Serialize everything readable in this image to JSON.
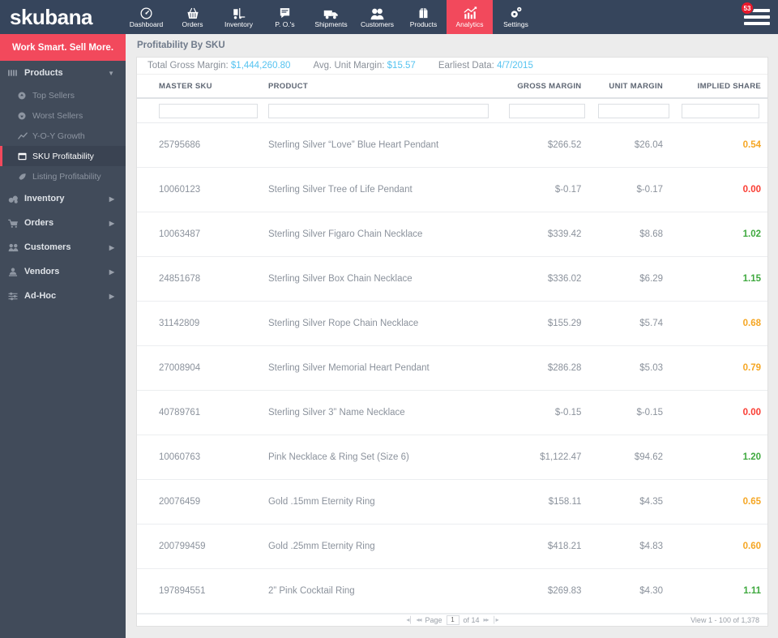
{
  "brand": {
    "name": "skubana",
    "accent": "#f2495c",
    "navy": "#36455c"
  },
  "topnav": {
    "items": [
      {
        "label": "Dashboard",
        "icon": "speedometer-icon",
        "active": false
      },
      {
        "label": "Orders",
        "icon": "basket-icon",
        "active": false
      },
      {
        "label": "Inventory",
        "icon": "forklift-icon",
        "active": false
      },
      {
        "label": "P. O.'s",
        "icon": "document-note-icon",
        "active": false
      },
      {
        "label": "Shipments",
        "icon": "truck-icon",
        "active": false
      },
      {
        "label": "Customers",
        "icon": "people-icon",
        "active": false
      },
      {
        "label": "Products",
        "icon": "box-icon",
        "active": false
      },
      {
        "label": "Analytics",
        "icon": "bar-chart-icon",
        "active": true
      },
      {
        "label": "Settings",
        "icon": "gears-icon",
        "active": false
      }
    ],
    "menu_badge": "53",
    "menu_icon": "hamburger-icon"
  },
  "sidebar": {
    "tagline": "Work Smart. Sell More.",
    "products": {
      "label": "Products",
      "icon": "bars-icon",
      "chevron": "chevron-down-icon"
    },
    "product_items": [
      {
        "label": "Top Sellers",
        "icon": "arrow-up-circle-icon",
        "active": false
      },
      {
        "label": "Worst Sellers",
        "icon": "arrow-down-circle-icon",
        "active": false
      },
      {
        "label": "Y-O-Y Growth",
        "icon": "trend-line-icon",
        "active": false
      },
      {
        "label": "SKU Profitability",
        "icon": "window-icon",
        "active": true
      },
      {
        "label": "Listing Profitability",
        "icon": "tag-icon",
        "active": false
      }
    ],
    "groups": [
      {
        "label": "Inventory",
        "icon": "boxes-icon",
        "chevron": "chevron-right-icon"
      },
      {
        "label": "Orders",
        "icon": "cart-icon",
        "chevron": "chevron-right-icon"
      },
      {
        "label": "Customers",
        "icon": "people-group-icon",
        "chevron": "chevron-right-icon"
      },
      {
        "label": "Vendors",
        "icon": "vendor-icon",
        "chevron": "chevron-right-icon"
      },
      {
        "label": "Ad-Hoc",
        "icon": "sliders-icon",
        "chevron": "chevron-right-icon"
      }
    ]
  },
  "page": {
    "title": "Profitability By SKU"
  },
  "summary": {
    "gross_margin_label": "Total Gross Margin:",
    "gross_margin_value": "$1,444,260.80",
    "avg_unit_label": "Avg. Unit Margin:",
    "avg_unit_value": "$15.57",
    "earliest_label": "Earliest Data:",
    "earliest_value": "4/7/2015"
  },
  "table": {
    "headers": {
      "sku": "MASTER SKU",
      "product": "PRODUCT",
      "gross_margin": "GROSS MARGIN",
      "unit_margin": "UNIT MARGIN",
      "implied_share": "IMPLIED SHARE"
    },
    "filters": {
      "sku": "",
      "product": "",
      "gross_margin": "",
      "unit_margin": "",
      "implied_share": ""
    },
    "rows": [
      {
        "sku": "25795686",
        "product": "Sterling Silver “Love” Blue Heart Pendant",
        "gross_margin": "$266.52",
        "unit_margin": "$26.04",
        "implied_share": "0.54",
        "share_color": "#f5a623"
      },
      {
        "sku": "10060123",
        "product": "Sterling Silver Tree of Life Pendant",
        "gross_margin": "$-0.17",
        "unit_margin": "$-0.17",
        "implied_share": "0.00",
        "share_color": "#fa3c32"
      },
      {
        "sku": "10063487",
        "product": "Sterling Silver Figaro Chain Necklace",
        "gross_margin": "$339.42",
        "unit_margin": "$8.68",
        "implied_share": "1.02",
        "share_color": "#3fa93f"
      },
      {
        "sku": "24851678",
        "product": "Sterling Silver Box Chain Necklace",
        "gross_margin": "$336.02",
        "unit_margin": "$6.29",
        "implied_share": "1.15",
        "share_color": "#3fa93f"
      },
      {
        "sku": "31142809",
        "product": "Sterling Silver Rope Chain Necklace",
        "gross_margin": "$155.29",
        "unit_margin": "$5.74",
        "implied_share": "0.68",
        "share_color": "#f5a623"
      },
      {
        "sku": "27008904",
        "product": "Sterling Silver Memorial Heart Pendant",
        "gross_margin": "$286.28",
        "unit_margin": "$5.03",
        "implied_share": "0.79",
        "share_color": "#f5a623"
      },
      {
        "sku": "40789761",
        "product": "Sterling Silver 3” Name Necklace",
        "gross_margin": "$-0.15",
        "unit_margin": "$-0.15",
        "implied_share": "0.00",
        "share_color": "#fa3c32"
      },
      {
        "sku": "10060763",
        "product": "Pink Necklace & Ring Set (Size 6)",
        "gross_margin": "$1,122.47",
        "unit_margin": "$94.62",
        "implied_share": "1.20",
        "share_color": "#3fa93f"
      },
      {
        "sku": "20076459",
        "product": "Gold .15mm Eternity Ring",
        "gross_margin": "$158.11",
        "unit_margin": "$4.35",
        "implied_share": "0.65",
        "share_color": "#f5a623"
      },
      {
        "sku": "200799459",
        "product": "Gold .25mm Eternity Ring",
        "gross_margin": "$418.21",
        "unit_margin": "$4.83",
        "implied_share": "0.60",
        "share_color": "#f5a623"
      },
      {
        "sku": "197894551",
        "product": "2” Pink Cocktail Ring",
        "gross_margin": "$269.83",
        "unit_margin": "$4.30",
        "implied_share": "1.11",
        "share_color": "#3fa93f"
      }
    ]
  },
  "pager": {
    "first": "◂│",
    "prev": "◂◂",
    "page_label": "Page",
    "page_value": "1",
    "of_label": "of 14",
    "next": "▸▸",
    "last": "│▸",
    "view_text": "View 1 - 100 of 1,378"
  }
}
